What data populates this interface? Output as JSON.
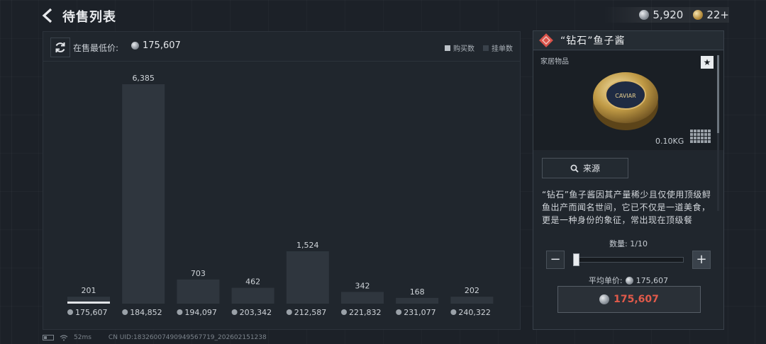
{
  "header": {
    "title": "待售列表"
  },
  "currency": {
    "coins": "5,920",
    "tickets": "22+"
  },
  "market": {
    "min_price_label": "在售最低价:",
    "min_price": "175,607",
    "legend": {
      "buy": "购买数",
      "listing": "挂单数"
    }
  },
  "chart_data": {
    "type": "bar",
    "categories": [
      "175,607",
      "184,852",
      "194,097",
      "203,342",
      "212,587",
      "221,832",
      "231,077",
      "240,322"
    ],
    "values": [
      201,
      6385,
      703,
      462,
      1524,
      342,
      168,
      202
    ],
    "labels": [
      "201",
      "6,385",
      "703",
      "462",
      "1,524",
      "342",
      "168",
      "202"
    ],
    "ylim": [
      0,
      6385
    ],
    "highlight_index": 0,
    "grid": false
  },
  "item": {
    "name": "“钻石”鱼子酱",
    "category": "家居物品",
    "weight": "0.10KG",
    "source_label": "来源",
    "description": "“钻石”鱼子酱因其产量稀少且仅使用顶级鲟鱼出产而闻名世间，它已不仅是一道美食，更是一种身份的象征，常出现在顶级餐",
    "quantity_label": "数量: 1/10",
    "quantity": 1,
    "quantity_max": 10,
    "avg_label": "平均单价:",
    "avg_price": "175,607",
    "total_price": "175,607",
    "tin_label": "CAVIAR"
  },
  "status": {
    "ping": "52ms",
    "uid": "CN UID:18326007490949567719_202602151238"
  },
  "colors": {
    "accent_red": "#e25a4a",
    "bar": "#2f363e",
    "bar_highlight": "#e0e3e6",
    "panel_bg": "#20262d"
  }
}
